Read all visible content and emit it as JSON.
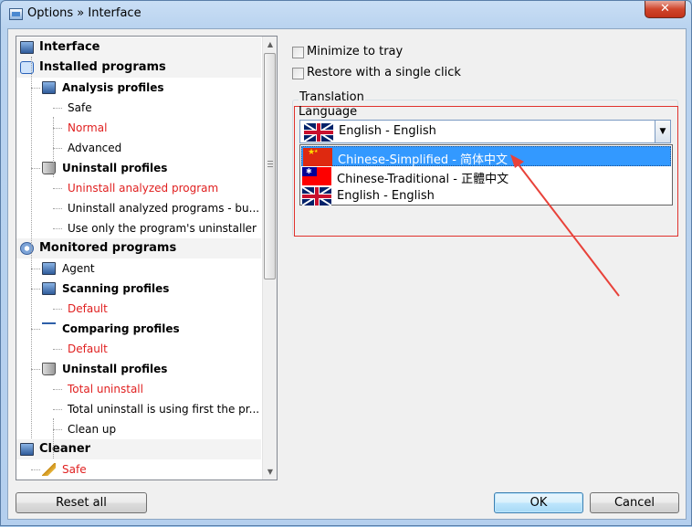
{
  "window": {
    "title": "Options » Interface",
    "close_label": "✕"
  },
  "tree": {
    "items": [
      {
        "label": "Interface",
        "kind": "header",
        "icon": "monitor-icon"
      },
      {
        "label": "Installed programs",
        "kind": "header",
        "icon": "box-icon"
      },
      {
        "label": "Analysis profiles",
        "kind": "sub",
        "icon": "monitor-icon"
      },
      {
        "label": "Safe",
        "kind": "leaf"
      },
      {
        "label": "Normal",
        "kind": "leaf",
        "highlight": true
      },
      {
        "label": "Advanced",
        "kind": "leaf"
      },
      {
        "label": "Uninstall profiles",
        "kind": "sub",
        "icon": "trash-icon"
      },
      {
        "label": "Uninstall analyzed program",
        "kind": "leaf",
        "highlight": true
      },
      {
        "label": "Uninstall analyzed programs - bu...",
        "kind": "leaf"
      },
      {
        "label": "Use only the program's uninstaller",
        "kind": "leaf"
      },
      {
        "label": "Monitored programs",
        "kind": "header",
        "icon": "gear-icon"
      },
      {
        "label": "Agent",
        "kind": "sub-plain",
        "icon": "monitor-icon"
      },
      {
        "label": "Scanning profiles",
        "kind": "sub",
        "icon": "monitor-icon"
      },
      {
        "label": "Default",
        "kind": "leaf",
        "highlight": true
      },
      {
        "label": "Comparing profiles",
        "kind": "sub",
        "icon": "scale-icon"
      },
      {
        "label": "Default",
        "kind": "leaf",
        "highlight": true
      },
      {
        "label": "Uninstall profiles",
        "kind": "sub",
        "icon": "trash-icon"
      },
      {
        "label": "Total uninstall",
        "kind": "leaf",
        "highlight": true
      },
      {
        "label": "Total uninstall is using first the pr...",
        "kind": "leaf"
      },
      {
        "label": "Clean up",
        "kind": "leaf"
      },
      {
        "label": "Cleaner",
        "kind": "header",
        "icon": "monitor-icon"
      },
      {
        "label": "Safe",
        "kind": "sub-plain",
        "icon": "broom-icon",
        "highlight": true
      }
    ]
  },
  "options": {
    "minimize_to_tray": "Minimize to tray",
    "restore_single_click": "Restore with a single click"
  },
  "translation": {
    "group_title": "Translation",
    "language_label": "Language",
    "selected": "English - English",
    "options": [
      {
        "label": "Chinese-Simplified - 简体中文",
        "flag": "cn",
        "selected": true
      },
      {
        "label": "Chinese-Traditional - 正體中文",
        "flag": "tw",
        "selected": false
      },
      {
        "label": "English - English",
        "flag": "uk",
        "selected": false
      }
    ]
  },
  "buttons": {
    "reset_all": "Reset all",
    "ok": "OK",
    "cancel": "Cancel"
  },
  "colors": {
    "highlight_text": "#e02020",
    "selection": "#3399ff",
    "annotation": "#e8423a"
  }
}
